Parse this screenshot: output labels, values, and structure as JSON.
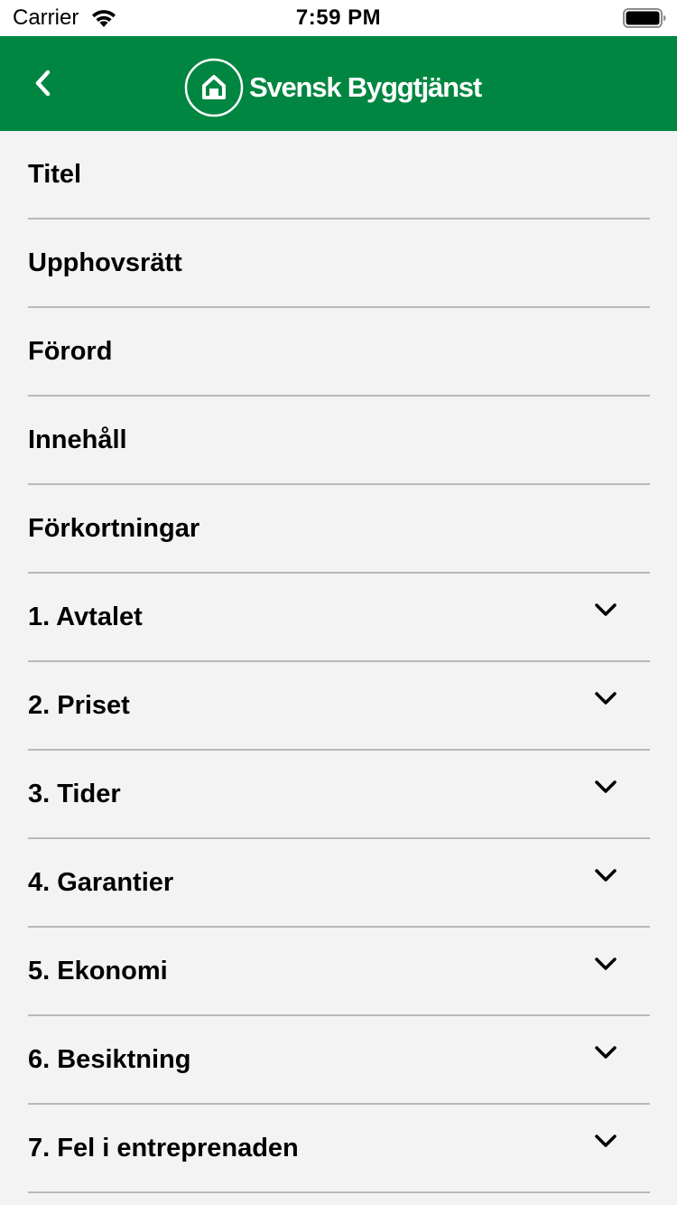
{
  "status_bar": {
    "carrier": "Carrier",
    "time": "7:59 PM",
    "wifi_icon": "wifi-icon",
    "battery_icon": "battery-full-icon"
  },
  "header": {
    "background_color": "#008641",
    "back_icon": "chevron-left-icon",
    "logo_icon": "house-circle-icon",
    "logo_text": "Svensk Byggtjänst"
  },
  "toc": {
    "items": [
      {
        "label": "Titel",
        "expandable": false
      },
      {
        "label": "Upphovsrätt",
        "expandable": false
      },
      {
        "label": "Förord",
        "expandable": false
      },
      {
        "label": "Innehåll",
        "expandable": false
      },
      {
        "label": "Förkortningar",
        "expandable": false
      },
      {
        "label": "1. Avtalet",
        "expandable": true
      },
      {
        "label": "2. Priset",
        "expandable": true
      },
      {
        "label": "3. Tider",
        "expandable": true
      },
      {
        "label": "4. Garantier",
        "expandable": true
      },
      {
        "label": "5. Ekonomi",
        "expandable": true
      },
      {
        "label": "6. Besiktning",
        "expandable": true
      },
      {
        "label": "7. Fel i entreprenaden",
        "expandable": true
      }
    ],
    "expand_icon": "chevron-down-icon",
    "divider_color": "#b9b9b9"
  }
}
